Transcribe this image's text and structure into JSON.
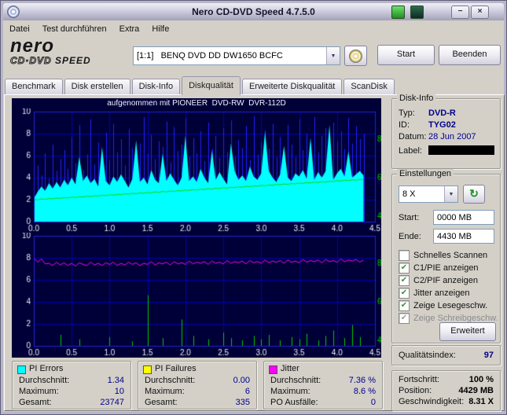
{
  "window": {
    "title": "Nero CD-DVD Speed 4.7.5.0"
  },
  "icons": {
    "minimize": "−",
    "close": "×",
    "combo_arrow": "▼",
    "refresh": "↻",
    "check": "✔"
  },
  "menu": {
    "items": [
      "Datei",
      "Test durchführen",
      "Extra",
      "Hilfe"
    ]
  },
  "toolbar": {
    "logo": {
      "line1": "nero",
      "line2a": "CD·DVD",
      "line2b": "SPEED"
    },
    "drive": "[1:1]   BENQ DVD DD DW1650 BCFC",
    "start_label": "Start",
    "quit_label": "Beenden"
  },
  "tabs": {
    "selected_index": 3,
    "items": [
      "Benchmark",
      "Disk erstellen",
      "Disk-Info",
      "Diskqualität",
      "Erweiterte Diskqualität",
      "ScanDisk"
    ]
  },
  "chart": {
    "caption": "aufgenommen mit PIONEER  DVD-RW  DVR-112D"
  },
  "chart_data": [
    {
      "type": "area",
      "name": "PI Errors",
      "canvas": "pie-chart-canvas",
      "x_ticks": [
        "0.0",
        "0.5",
        "1.0",
        "1.5",
        "2.0",
        "2.5",
        "3.0",
        "3.5",
        "4.0",
        "4.5"
      ],
      "y_ticks": [
        "10",
        "8",
        "6",
        "4",
        "2",
        "0"
      ],
      "right_ticks": {
        "labels": [
          "8",
          "6",
          "4"
        ],
        "fractions": [
          0.25,
          0.6,
          0.95
        ],
        "color": "#00c800"
      },
      "x_range": [
        0,
        4.5
      ],
      "y_range": [
        0,
        10
      ],
      "x_step": 0.05,
      "bg": "#000038",
      "grid_color": "#0000b8",
      "border_color": "#2121d6",
      "label_color": "#e9e9f6",
      "series": [
        {
          "name": "PIE max",
          "type": "spikes",
          "color": "#2020ff",
          "values": [
            3.4,
            5.1,
            4.2,
            6.2,
            3.9,
            7.0,
            4.6,
            5.7,
            6.5,
            4.8,
            7.7,
            5.3,
            8.8,
            4.7,
            6.1,
            9.3,
            5.2,
            7.2,
            6.0,
            8.1,
            5.6,
            8.9,
            6.3,
            7.5,
            5.1,
            8.4,
            6.7,
            5.9,
            7.1,
            9.5,
            6.2,
            7.9,
            5.7,
            7.3,
            6.8,
            9.1,
            5.4,
            8.6,
            6.4,
            7.0,
            9.4,
            5.9,
            7.6,
            6.2,
            8.2,
            5.5,
            9.0,
            6.6,
            7.8,
            5.8,
            8.5,
            6.3,
            9.2,
            5.9,
            7.4,
            6.7,
            8.7,
            5.6,
            9.6,
            6.1,
            7.2,
            8.3,
            6.6,
            8.9,
            5.9,
            7.7,
            6.4,
            8.8,
            7.0,
            5.9,
            9.3,
            6.5,
            8.0,
            7.2,
            9.5,
            6.3,
            7.8,
            8.5,
            6.8,
            9.0,
            7.3,
            8.2,
            6.6,
            9.4,
            7.1,
            8.7,
            7.5,
            8.0
          ]
        },
        {
          "name": "PI Errors",
          "type": "area",
          "color": "#00ffff",
          "values": [
            2.1,
            2.7,
            3.2,
            2.8,
            3.5,
            3.0,
            3.6,
            3.1,
            3.8,
            3.3,
            4.0,
            3.4,
            5.9,
            3.7,
            4.2,
            3.5,
            3.9,
            3.2,
            6.8,
            3.7,
            3.3,
            4.1,
            3.6,
            4.3,
            3.7,
            3.1,
            3.9,
            7.4,
            3.6,
            4.0,
            3.4,
            4.7,
            3.8,
            3.5,
            6.2,
            3.7,
            4.4,
            3.8,
            3.3,
            4.0,
            7.8,
            3.7,
            4.1,
            3.6,
            4.8,
            4.0,
            3.5,
            6.5,
            3.8,
            4.5,
            3.9,
            3.4,
            7.1,
            4.6,
            3.8,
            4.2,
            3.7,
            5.0,
            4.1,
            3.8,
            4.4,
            8.2,
            4.6,
            4.0,
            3.6,
            4.3,
            6.9,
            4.0,
            3.7,
            4.4,
            4.1,
            4.7,
            3.9,
            7.6,
            3.8,
            4.5,
            4.0,
            4.6,
            8.8,
            3.8,
            4.4,
            4.8,
            4.1,
            6.4,
            4.0,
            4.3,
            4.6,
            4.2
          ]
        },
        {
          "name": "Lesegeschwindigkeit",
          "type": "line",
          "color": "#00dc00",
          "values": [
            2.02,
            1.99,
            2.06,
            2.03,
            2.1,
            2.07,
            2.14,
            2.11,
            2.19,
            2.16,
            2.23,
            2.2,
            2.27,
            2.24,
            2.31,
            2.28,
            2.36,
            2.33,
            2.4,
            2.37,
            2.44,
            2.41,
            2.48,
            2.45,
            2.53,
            2.5,
            2.57,
            2.54,
            2.61,
            2.58,
            2.65,
            2.62,
            2.7,
            2.67,
            2.74,
            2.71,
            2.78,
            2.75,
            2.82,
            2.79,
            2.87,
            2.84,
            2.91,
            2.88,
            2.95,
            2.92,
            2.99,
            2.96,
            3.04,
            3.01,
            3.08,
            3.05,
            3.12,
            3.09,
            3.16,
            3.13,
            3.21,
            3.18,
            3.25,
            3.22,
            3.29,
            3.26,
            3.33,
            3.3,
            3.38,
            3.35,
            3.42,
            3.39,
            3.46,
            3.43,
            3.5,
            3.47,
            3.55,
            3.52,
            3.59,
            3.56,
            3.63,
            3.6,
            3.67,
            3.64,
            3.72,
            3.69,
            3.76,
            3.73,
            3.8,
            3.77,
            3.84,
            3.81
          ]
        }
      ]
    },
    {
      "type": "line",
      "name": "PI Failures / Jitter",
      "canvas": "pif-chart-canvas",
      "x_ticks": [
        "0.0",
        "0.5",
        "1.0",
        "1.5",
        "2.0",
        "2.5",
        "3.0",
        "3.5",
        "4.0",
        "4.5"
      ],
      "y_ticks": [
        "10",
        "8",
        "6",
        "4",
        "2",
        "0"
      ],
      "right_ticks": {
        "labels": [
          "8",
          "6",
          "4"
        ],
        "fractions": [
          0.25,
          0.6,
          0.95
        ],
        "color": "#00c800"
      },
      "x_range": [
        0,
        4.5
      ],
      "y_range": [
        0,
        10
      ],
      "x_step": 0.05,
      "bg": "#000038",
      "grid_color": "#0000b8",
      "border_color": "#2121d6",
      "label_color": "#e9e9f6",
      "series": [
        {
          "name": "PI Failures",
          "type": "spikes",
          "color": "#00c800",
          "values": [
            0,
            0,
            0,
            0,
            0,
            0,
            0,
            1.0,
            0,
            0,
            0,
            0,
            0.6,
            0,
            0,
            0,
            0,
            0,
            0,
            0,
            0.8,
            0,
            0,
            0,
            0,
            0,
            0.4,
            0,
            0,
            0,
            4.6,
            0,
            0,
            0,
            0.7,
            0,
            0,
            0,
            0,
            2.4,
            0,
            0,
            0.9,
            0,
            0,
            0,
            0.6,
            0,
            0,
            0,
            1.2,
            0,
            0.7,
            0,
            0,
            0.5,
            0,
            0,
            0.9,
            0,
            0.6,
            0,
            1.0,
            0,
            0,
            0.5,
            0,
            0,
            0.8,
            0,
            0.6,
            0,
            1.1,
            0,
            0,
            0.5,
            0,
            0.9,
            0,
            1.4,
            0,
            0,
            0.7,
            0,
            1.9,
            0,
            0.8,
            0
          ]
        },
        {
          "name": "Jitter",
          "type": "line",
          "color": "#ff00ff",
          "values": [
            8.0,
            7.6,
            7.9,
            7.45,
            7.5,
            7.3,
            7.6,
            7.35,
            7.55,
            7.3,
            7.5,
            7.25,
            7.55,
            7.4,
            7.3,
            7.6,
            7.35,
            7.5,
            7.3,
            7.55,
            7.4,
            7.6,
            7.3,
            7.5,
            7.35,
            7.6,
            7.4,
            7.55,
            7.3,
            7.5,
            7.4,
            7.65,
            7.35,
            7.55,
            7.45,
            7.6,
            7.35,
            7.65,
            7.45,
            7.55,
            7.4,
            7.7,
            7.45,
            7.6,
            7.5,
            7.65,
            7.4,
            7.7,
            7.5,
            7.6,
            7.45,
            7.75,
            7.5,
            7.65,
            7.55,
            7.7,
            7.45,
            7.75,
            7.55,
            7.65,
            7.5,
            7.8,
            7.55,
            7.7,
            7.6,
            7.75,
            7.5,
            7.8,
            7.6,
            7.7,
            7.55,
            7.85,
            7.6,
            7.75,
            7.65,
            7.8,
            7.55,
            7.85,
            7.65,
            7.75,
            7.6,
            7.9,
            7.65,
            7.8,
            7.7,
            7.85,
            7.6,
            7.8
          ]
        }
      ]
    }
  ],
  "disk_info": {
    "title": "Disk-Info",
    "rows": [
      {
        "label": "Typ:",
        "value": "DVD-R"
      },
      {
        "label": "ID:",
        "value": "TYG02"
      },
      {
        "label": "Datum:",
        "value": "28 Jun 2007"
      },
      {
        "label": "Label:",
        "value": ""
      }
    ]
  },
  "settings": {
    "title": "Einstellungen",
    "speed_value": "8 X",
    "start_label": "Start:",
    "start_value": "0000 MB",
    "end_label": "Ende:",
    "end_value": "4430 MB",
    "advanced_label": "Erweitert",
    "checkboxes": [
      {
        "label": "Schnelles Scannen",
        "checked": false,
        "disabled": false
      },
      {
        "label": "C1/PIE anzeigen",
        "checked": true,
        "disabled": false
      },
      {
        "label": "C2/PIF anzeigen",
        "checked": true,
        "disabled": false
      },
      {
        "label": "Jitter anzeigen",
        "checked": true,
        "disabled": false
      },
      {
        "label": "Zeige Lesegeschw.",
        "checked": true,
        "disabled": false
      },
      {
        "label": "Zeige Schreibgeschw.",
        "checked": true,
        "disabled": true
      }
    ]
  },
  "quality": {
    "label": "Qualitätsindex:",
    "value": "97"
  },
  "progress": {
    "rows": [
      {
        "label": "Fortschritt:",
        "value": "100 %"
      },
      {
        "label": "Position:",
        "value": "4429 MB"
      },
      {
        "label": "Geschwindigkeit:",
        "value": "8.31 X"
      }
    ]
  },
  "legend_panels": [
    {
      "title": "PI Errors",
      "color": "#00ffff",
      "rows": [
        {
          "label": "Durchschnitt:",
          "value": "1.34"
        },
        {
          "label": "Maximum:",
          "value": "10"
        },
        {
          "label": "Gesamt:",
          "value": "23747"
        }
      ]
    },
    {
      "title": "PI Failures",
      "color": "#ffff00",
      "rows": [
        {
          "label": "Durchschnitt:",
          "value": "0.00"
        },
        {
          "label": "Maximum:",
          "value": "6"
        },
        {
          "label": "Gesamt:",
          "value": "335"
        }
      ]
    },
    {
      "title": "Jitter",
      "color": "#ff00ff",
      "rows": [
        {
          "label": "Durchschnitt:",
          "value": "7.36 %"
        },
        {
          "label": "Maximum:",
          "value": "8.6 %"
        },
        {
          "label": "PO Ausfälle:",
          "value": "0"
        }
      ]
    }
  ]
}
